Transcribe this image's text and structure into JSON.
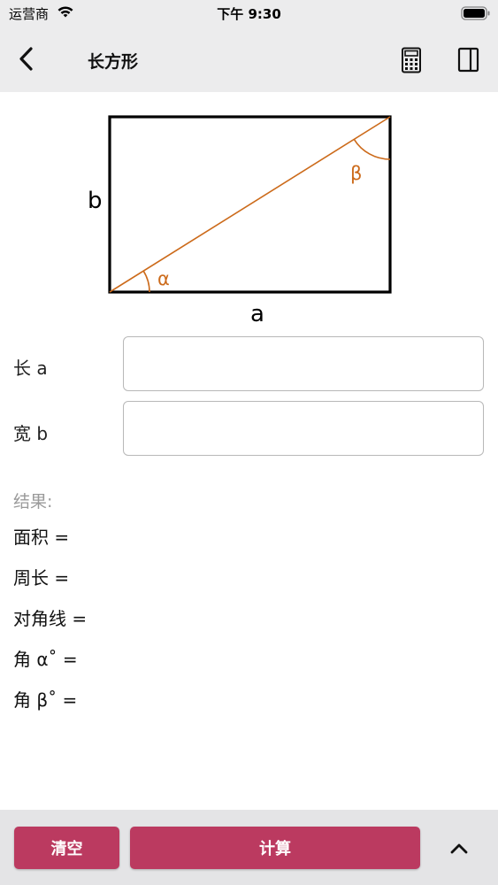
{
  "status_bar": {
    "carrier": "运营商",
    "time": "下午 9:30",
    "wifi_icon": "wifi-icon",
    "battery_icon": "battery-icon"
  },
  "nav": {
    "title": "长方形",
    "back_icon": "chevron-left-icon",
    "calculator_icon": "calculator-icon",
    "panel_icon": "sidebar-panel-icon"
  },
  "diagram": {
    "side_a": "a",
    "side_b": "b",
    "angle_alpha": "α",
    "angle_beta": "β",
    "rect_color": "#000000",
    "diagonal_color": "#cc6a1a"
  },
  "inputs": {
    "length": {
      "label": "长  a",
      "value": ""
    },
    "width": {
      "label": "宽  b",
      "value": ""
    }
  },
  "results": {
    "title": "结果:",
    "area": "面积 =",
    "perimeter": "周长 =",
    "diagonal": "对角线 =",
    "angle_alpha": "角  α˚ =",
    "angle_beta": "角  β˚ ="
  },
  "footer": {
    "clear_label": "清空",
    "calculate_label": "计算",
    "collapse_icon": "chevron-up-icon",
    "button_color": "#bb3a60"
  }
}
